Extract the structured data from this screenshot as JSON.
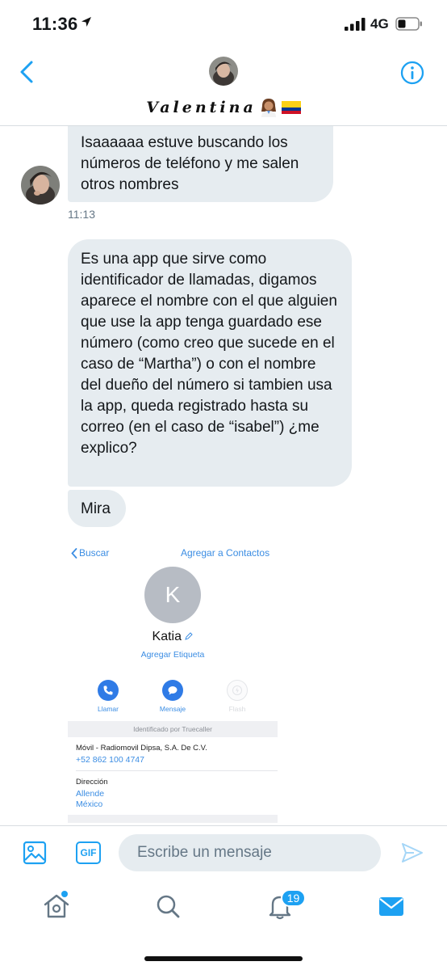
{
  "status_bar": {
    "time": "11:36",
    "network": "4G"
  },
  "header": {
    "contact_name": "Valentina",
    "name_emojis": [
      "woman-health-worker-emoji",
      "colombia-flag-emoji"
    ]
  },
  "messages": [
    {
      "id": 1,
      "text": "Isaaaaaa estuve buscando los números de teléfono y me salen otros nombres",
      "timestamp": "11:13"
    },
    {
      "id": 2,
      "text": "Es una app que sirve como identificador de llamadas, digamos aparece el nombre con el que alguien que use la app tenga guardado ese número (como creo que sucede en el caso de “Martha”) o con el nombre del dueño del número si tambien usa la app, queda registrado hasta su correo (en el caso de “isabel”) ¿me explico?"
    },
    {
      "id": 3,
      "text": "Mira"
    }
  ],
  "attachment": {
    "back_label": "Buscar",
    "add_label": "Agregar a Contactos",
    "avatar_initial": "K",
    "name": "Katia",
    "tag_label": "Agregar Etiqueta",
    "actions": [
      {
        "label": "Llamar",
        "icon": "phone-icon"
      },
      {
        "label": "Mensaje",
        "icon": "message-icon"
      },
      {
        "label": "Flash",
        "icon": "flash-icon"
      }
    ],
    "identified_by": "Identificado por Truecaller",
    "carrier": "Móvil - Radiomovil Dipsa, S.A. De C.V.",
    "phone": "+52 862 100 4747",
    "address_label": "Dirección",
    "address_line1": "Allende",
    "address_line2": "México"
  },
  "composer": {
    "placeholder": "Escribe un mensaje",
    "gif_label": "GIF"
  },
  "tab_bar": {
    "notifications_count": "19"
  },
  "colors": {
    "accent": "#1da1f2",
    "bubble": "#e6ecf0",
    "secondary_text": "#657786"
  }
}
